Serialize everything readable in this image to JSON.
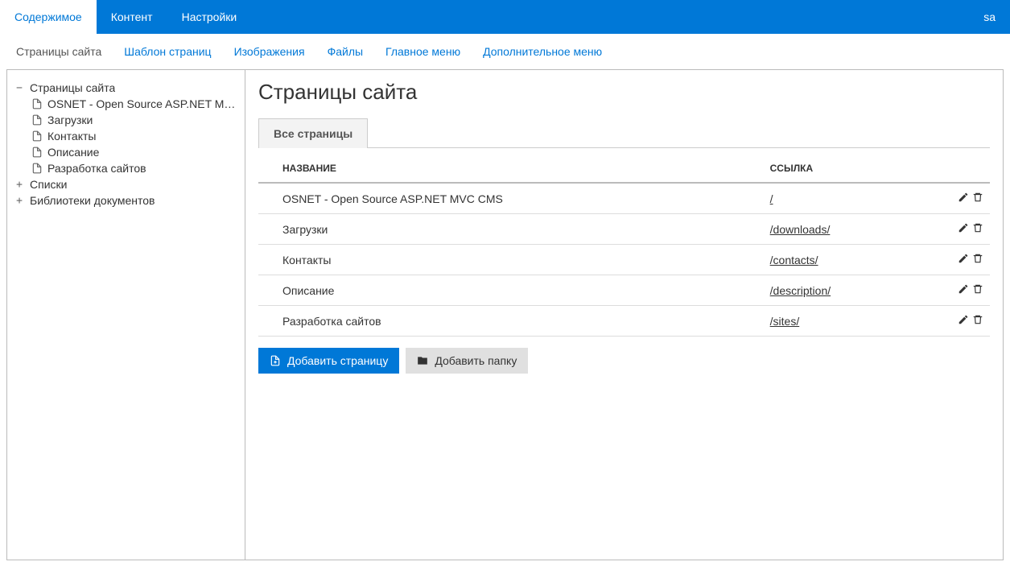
{
  "topbar": {
    "tabs": [
      {
        "label": "Содержимое",
        "active": true
      },
      {
        "label": "Контент",
        "active": false
      },
      {
        "label": "Настройки",
        "active": false
      }
    ],
    "user": "sa"
  },
  "subnav": [
    {
      "label": "Страницы сайта",
      "current": true
    },
    {
      "label": "Шаблон страниц",
      "current": false
    },
    {
      "label": "Изображения",
      "current": false
    },
    {
      "label": "Файлы",
      "current": false
    },
    {
      "label": "Главное меню",
      "current": false
    },
    {
      "label": "Дополнительное меню",
      "current": false
    }
  ],
  "sidebar": {
    "nodes": [
      {
        "label": "Страницы сайта",
        "toggle": "−",
        "children": [
          {
            "label": "OSNET - Open Source ASP.NET M…"
          },
          {
            "label": "Загрузки"
          },
          {
            "label": "Контакты"
          },
          {
            "label": "Описание"
          },
          {
            "label": "Разработка сайтов"
          }
        ]
      },
      {
        "label": "Списки",
        "toggle": "+"
      },
      {
        "label": "Библиотеки документов",
        "toggle": "+"
      }
    ]
  },
  "main": {
    "title": "Страницы сайта",
    "tab_label": "Все страницы",
    "columns": {
      "name": "НАЗВАНИЕ",
      "link": "ССЫЛКА"
    },
    "rows": [
      {
        "name": "OSNET - Open Source ASP.NET MVC CMS",
        "link": "/"
      },
      {
        "name": "Загрузки",
        "link": "/downloads/"
      },
      {
        "name": "Контакты",
        "link": "/contacts/"
      },
      {
        "name": "Описание",
        "link": "/description/"
      },
      {
        "name": "Разработка сайтов",
        "link": "/sites/"
      }
    ],
    "buttons": {
      "add_page": "Добавить страницу",
      "add_folder": "Добавить папку"
    }
  }
}
